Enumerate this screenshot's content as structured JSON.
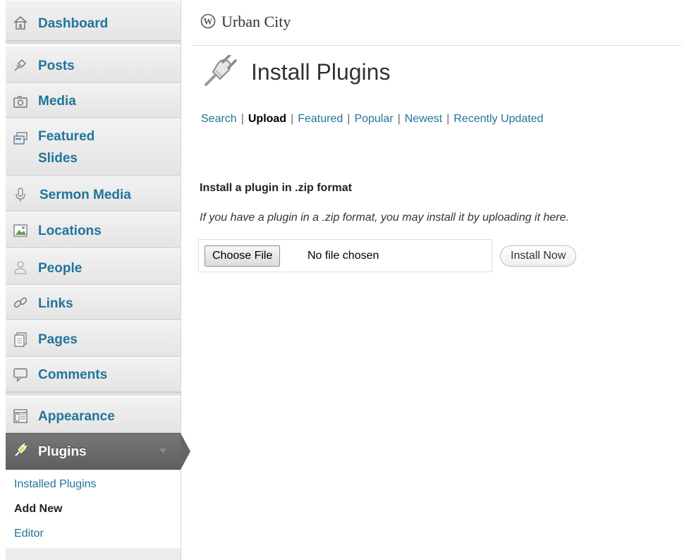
{
  "site": {
    "name": "Urban City",
    "logo_icon": "wordpress-logo-icon"
  },
  "sidebar": {
    "items": [
      {
        "key": "dashboard",
        "label": "Dashboard",
        "icon": "house-icon"
      },
      {
        "key": "posts",
        "label": "Posts",
        "icon": "pushpin-icon"
      },
      {
        "key": "media",
        "label": "Media",
        "icon": "camera-icon"
      },
      {
        "key": "featured-slides",
        "label": "Featured Slides",
        "line1": "Featured",
        "line2": "Slides",
        "icon": "slides-icon"
      },
      {
        "key": "sermon-media",
        "label": "Sermon Media",
        "icon": "microphone-icon"
      },
      {
        "key": "locations",
        "label": "Locations",
        "icon": "picture-icon"
      },
      {
        "key": "people",
        "label": "People",
        "icon": "person-icon"
      },
      {
        "key": "links",
        "label": "Links",
        "icon": "chain-link-icon"
      },
      {
        "key": "pages",
        "label": "Pages",
        "icon": "pages-icon"
      },
      {
        "key": "comments",
        "label": "Comments",
        "icon": "speech-bubble-icon"
      },
      {
        "key": "appearance",
        "label": "Appearance",
        "icon": "layout-icon"
      },
      {
        "key": "plugins",
        "label": "Plugins",
        "icon": "plug-icon",
        "active": true
      }
    ],
    "submenu": [
      {
        "label": "Installed Plugins",
        "current": false
      },
      {
        "label": "Add New",
        "current": true
      },
      {
        "label": "Editor",
        "current": false
      }
    ]
  },
  "page": {
    "title": "Install Plugins",
    "title_icon": "plug-icon"
  },
  "subnav": {
    "items": [
      {
        "label": "Search",
        "current": false
      },
      {
        "label": "Upload",
        "current": true
      },
      {
        "label": "Featured",
        "current": false
      },
      {
        "label": "Popular",
        "current": false
      },
      {
        "label": "Newest",
        "current": false
      },
      {
        "label": "Recently Updated",
        "current": false
      }
    ],
    "separator": "|"
  },
  "upload": {
    "heading": "Install a plugin in .zip format",
    "description": "If you have a plugin in a .zip format, you may install it by uploading it here.",
    "choose_file_label": "Choose File",
    "file_status": "No file chosen",
    "install_label": "Install Now"
  },
  "colors": {
    "link": "#21759b",
    "sidebar_bg": "#ececec",
    "active_bg": "#6b6b6b"
  }
}
